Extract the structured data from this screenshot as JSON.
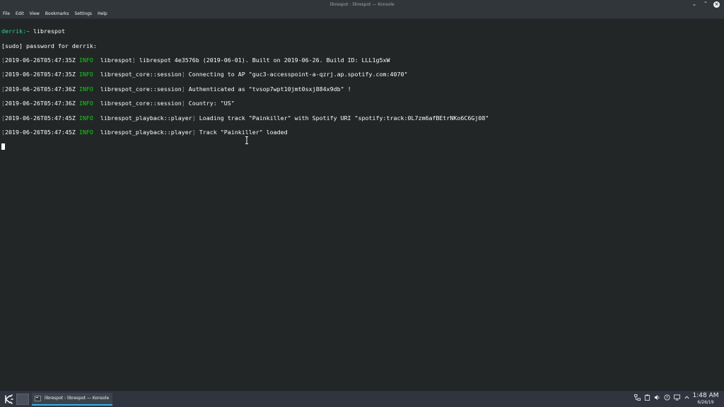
{
  "window": {
    "title": "librespot : librespot — Konsole"
  },
  "menu": [
    "File",
    "Edit",
    "View",
    "Bookmarks",
    "Settings",
    "Help"
  ],
  "terminal": {
    "prompt_user": "derrik",
    "prompt_path": ":~",
    "command": "librespot",
    "sudo_line": "[sudo] password for derrik:",
    "log": [
      {
        "ts": "2019-06-26T05:47:35Z",
        "level": "INFO",
        "module": "librespot",
        "msg": "librespot 4e3576b (2019-06-01). Built on 2019-06-26. Build ID: LLL1g5xW"
      },
      {
        "ts": "2019-06-26T05:47:35Z",
        "level": "INFO",
        "module": "librespot_core::session",
        "msg": "Connecting to AP \"guc3-accesspoint-a-qzrj.ap.spotify.com:4070\""
      },
      {
        "ts": "2019-06-26T05:47:36Z",
        "level": "INFO",
        "module": "librespot_core::session",
        "msg": "Authenticated as \"tvsop7wpt10jmt0sxj884x9db\" !"
      },
      {
        "ts": "2019-06-26T05:47:36Z",
        "level": "INFO",
        "module": "librespot_core::session",
        "msg": "Country: \"US\""
      },
      {
        "ts": "2019-06-26T05:47:45Z",
        "level": "INFO",
        "module": "librespot_playback::player",
        "msg": "Loading track \"Painkiller\" with Spotify URI \"spotify:track:0L7zm6afBEtrNKo6C6Gj08\""
      },
      {
        "ts": "2019-06-26T05:47:45Z",
        "level": "INFO",
        "module": "librespot_playback::player",
        "msg": "Track \"Painkiller\" loaded"
      }
    ]
  },
  "taskbar": {
    "task_label": "librespot : librespot — Konsole",
    "tray_icons": [
      "network-icon",
      "clipboard-icon",
      "volume-icon",
      "notifications-icon",
      "monitor-icon",
      "expand-tray-icon"
    ],
    "time": "1:48 AM",
    "date": "6/26/19"
  }
}
